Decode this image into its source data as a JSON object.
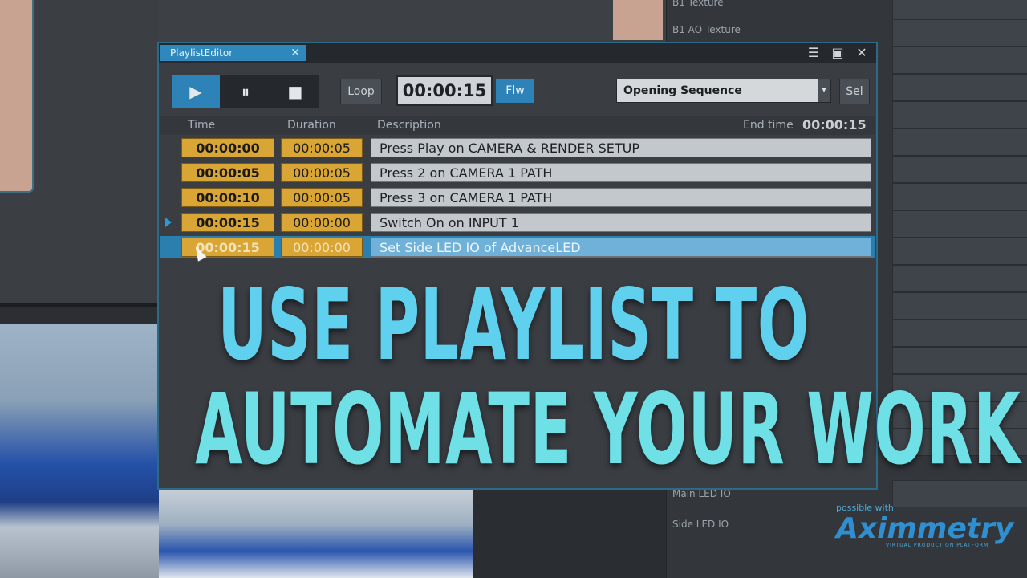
{
  "window": {
    "tab_title": "PlaylistEditor",
    "tab_close": "✕",
    "controls": {
      "menu": "☰",
      "maximize": "▣",
      "close": "✕"
    }
  },
  "toolbar": {
    "play": "▶",
    "pause": "⏸",
    "stop": "■",
    "loop_label": "Loop",
    "current_time": "00:00:15",
    "flw_label": "Flw",
    "sequence_value": "Opening Sequence",
    "dropdown_arrow": "▾",
    "sel_label": "Sel"
  },
  "columns": {
    "time": "Time",
    "duration": "Duration",
    "description": "Description",
    "end_time_label": "End time",
    "end_time_value": "00:00:15"
  },
  "rows": [
    {
      "time": "00:00:00",
      "duration": "00:00:05",
      "description": "Press Play on CAMERA & RENDER SETUP"
    },
    {
      "time": "00:00:05",
      "duration": "00:00:05",
      "description": "Press 2 on CAMERA 1 PATH"
    },
    {
      "time": "00:00:10",
      "duration": "00:00:05",
      "description": "Press 3 on CAMERA 1 PATH"
    },
    {
      "time": "00:00:15",
      "duration": "00:00:00",
      "description": "Switch On on INPUT 1"
    },
    {
      "time": "00:00:15",
      "duration": "00:00:00",
      "description": "Set Side LED IO of AdvanceLED"
    }
  ],
  "background_panel": {
    "labels": [
      "B1 Texture",
      "B1 AO Texture",
      "Main LED IO",
      "Side LED IO"
    ]
  },
  "headline": {
    "line1": "USE PLAYLIST TO",
    "line2": "AUTOMATE YOUR WORK"
  },
  "logo": {
    "small": "possible with",
    "name": "Aximmetry",
    "tagline": "VIRTUAL PRODUCTION PLATFORM"
  },
  "colors": {
    "accent_blue": "#2d82b8",
    "time_cell": "#d9a535",
    "headline": "#5fd1ee"
  }
}
